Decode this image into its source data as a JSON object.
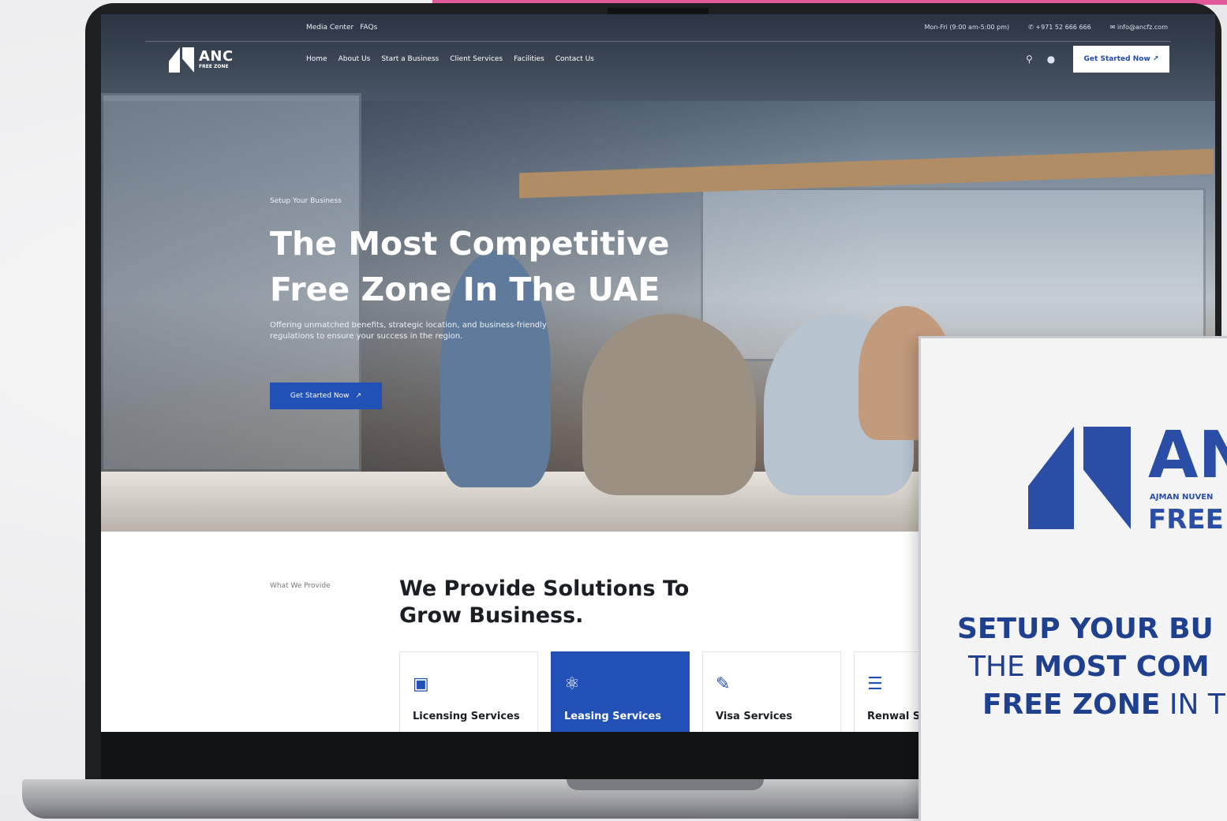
{
  "topbar": {
    "left_links": [
      "Media Center",
      "FAQs"
    ],
    "hours": "Mon-Fri (9:00 am-5:00 pm)",
    "phone": "+971 52 666 666",
    "email": "info@ancfz.com"
  },
  "logo": {
    "name": "ANC",
    "tagline": "FREE ZONE"
  },
  "nav": {
    "items": [
      "Home",
      "About Us",
      "Start a Business",
      "Client Services",
      "Facilities",
      "Contact Us"
    ],
    "cta_label": "Get Started Now ↗",
    "search_icon": "search-icon",
    "language_icon": "globe-icon"
  },
  "hero": {
    "kicker": "Setup Your Business",
    "title_line1": "The Most Competitive",
    "title_line2": "Free Zone In The UAE",
    "description": "Offering unmatched benefits, strategic location, and business-friendly regulations to ensure your success in the region.",
    "cta_label": "Get Started Now",
    "cta_arrow": "↗"
  },
  "solutions": {
    "kicker": "What We Provide",
    "title_line1": "We Provide Solutions To",
    "title_line2": "Grow Business.",
    "cards": [
      {
        "label": "Licensing Services",
        "icon": "license-icon",
        "active": false
      },
      {
        "label": "Leasing Services",
        "icon": "leasing-icon",
        "active": true
      },
      {
        "label": "Visa Services",
        "icon": "visa-icon",
        "active": false
      },
      {
        "label": "Renwal S",
        "icon": "renewal-icon",
        "active": false
      }
    ]
  },
  "standee": {
    "logo_text": "AN",
    "subtitle": "AJMAN NUVEN",
    "free": "FREE",
    "line1": "SETUP YOUR BU",
    "line2_light": "THE ",
    "line2_bold": "MOST COM",
    "line3_bold": "FREE ZONE",
    "line3_light": " IN T"
  },
  "colors": {
    "brand_blue": "#2150b7",
    "standee_blue": "#2a4ea5",
    "accent_pink": "#e05a9c"
  }
}
